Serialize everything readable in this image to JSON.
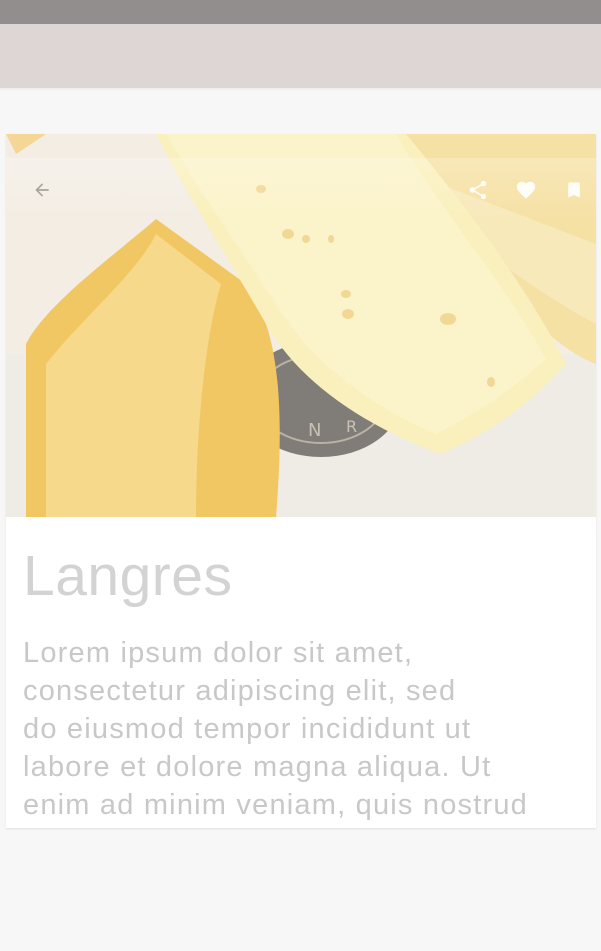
{
  "app": {
    "title": "Langres",
    "colors": {
      "status_bar": "#928e8e",
      "app_bar": "#ddd6d5",
      "background": "#f8f7f7",
      "card": "#ffffff",
      "title_text": "#d3d3d3",
      "body_text": "#c8c8c8"
    }
  },
  "detail_card": {
    "image": {
      "subject": "Langres cheese wedges on a board"
    },
    "toolbar": {
      "back_icon": "arrow-back-icon",
      "actions": [
        "share-icon",
        "favorite-icon",
        "bookmark-icon"
      ]
    },
    "title": "Langres",
    "description_lines": [
      "Lorem ipsum dolor sit amet,",
      "consectetur adipiscing elit, sed",
      "do eiusmod tempor incididunt ut",
      "labore et dolore magna aliqua. Ut",
      "enim ad minim veniam, quis nostrud"
    ]
  }
}
